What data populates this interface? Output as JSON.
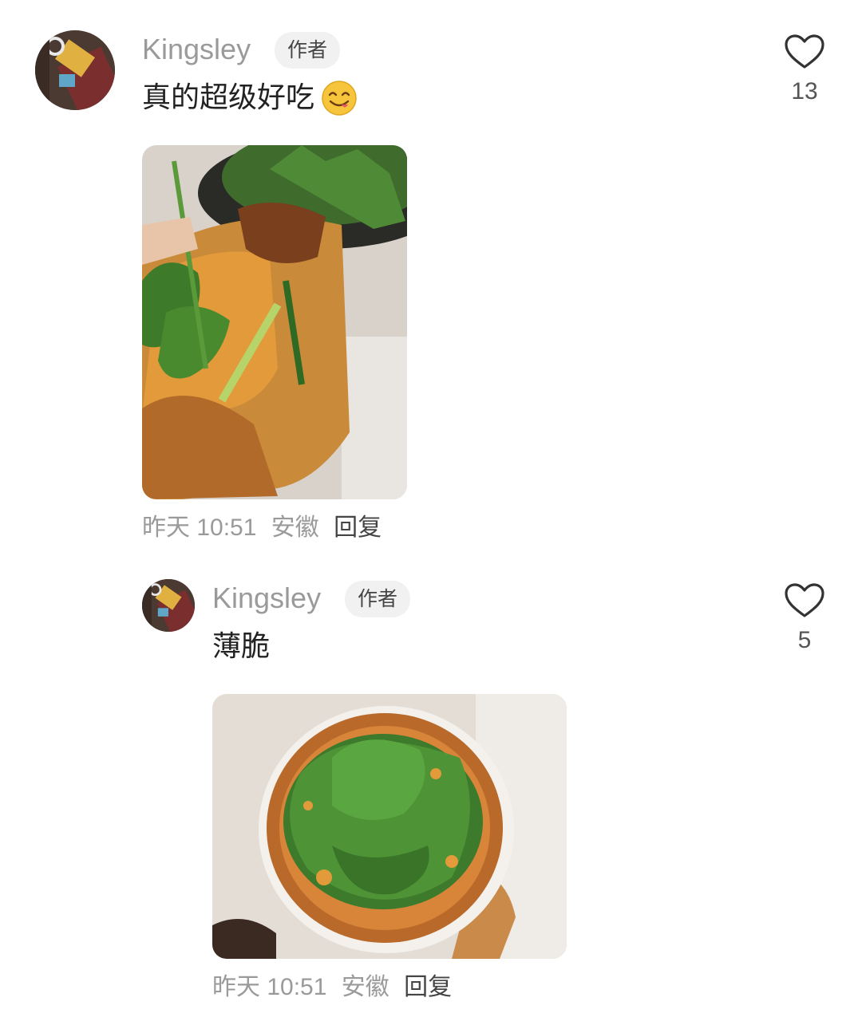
{
  "comments": [
    {
      "username": "Kingsley",
      "badge": "作者",
      "text": "真的超级好吃",
      "time": "昨天 10:51",
      "location": "安徽",
      "reply_label": "回复",
      "like_count": "13",
      "emoji_icon": "savoring-food-emoji",
      "like_icon": "heart-outline-icon"
    },
    {
      "username": "Kingsley",
      "badge": "作者",
      "text": "薄脆",
      "time": "昨天 10:51",
      "location": "安徽",
      "reply_label": "回复",
      "like_count": "5",
      "like_icon": "heart-outline-icon"
    }
  ],
  "colors": {
    "username": "#9a9a9a",
    "badge_bg": "#f1f1f1",
    "meta": "#9a9a9a",
    "text": "#222222"
  }
}
